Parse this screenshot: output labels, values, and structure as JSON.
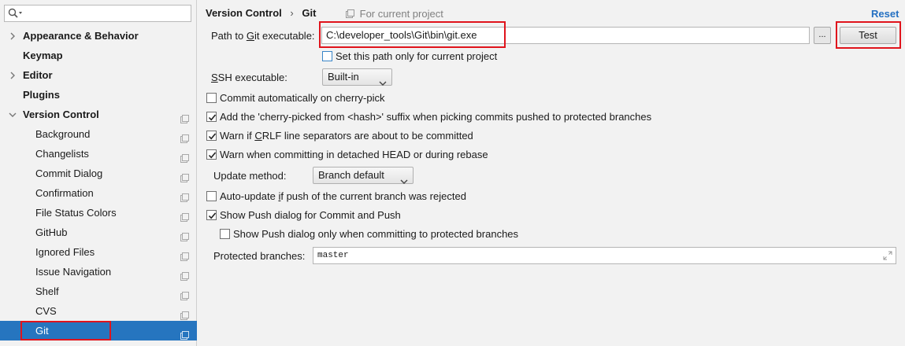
{
  "sidebar": {
    "search": {
      "value": ""
    },
    "items": [
      {
        "label": "Appearance & Behavior",
        "level": "top",
        "arrow": "right",
        "project": false
      },
      {
        "label": "Keymap",
        "level": "top",
        "arrow": "none",
        "project": false
      },
      {
        "label": "Editor",
        "level": "top",
        "arrow": "right",
        "project": false
      },
      {
        "label": "Plugins",
        "level": "top",
        "arrow": "none",
        "project": false
      },
      {
        "label": "Version Control",
        "level": "top",
        "arrow": "down",
        "project": true
      },
      {
        "label": "Background",
        "level": "sub",
        "project": true
      },
      {
        "label": "Changelists",
        "level": "sub",
        "project": true
      },
      {
        "label": "Commit Dialog",
        "level": "sub",
        "project": true
      },
      {
        "label": "Confirmation",
        "level": "sub",
        "project": true
      },
      {
        "label": "File Status Colors",
        "level": "sub",
        "project": true
      },
      {
        "label": "GitHub",
        "level": "sub",
        "project": true
      },
      {
        "label": "Ignored Files",
        "level": "sub",
        "project": true
      },
      {
        "label": "Issue Navigation",
        "level": "sub",
        "project": true
      },
      {
        "label": "Shelf",
        "level": "sub",
        "project": true
      },
      {
        "label": "CVS",
        "level": "sub",
        "project": true
      },
      {
        "label": "Git",
        "level": "sub",
        "project": true,
        "selected": true
      }
    ]
  },
  "header": {
    "breadcrumb_parent": "Version Control",
    "breadcrumb_separator": "›",
    "breadcrumb_current": "Git",
    "for_project": "For current project",
    "reset_label": "Reset"
  },
  "git_path": {
    "label_pre": "Path to ",
    "label_mn": "G",
    "label_post": "it executable:",
    "value": "C:\\developer_tools\\Git\\bin\\git.exe",
    "browse_label": "...",
    "test_label": "Test",
    "current_project_only": {
      "label": "Set this path only for current project",
      "checked": false
    }
  },
  "ssh": {
    "label_mn": "S",
    "label_post": "SH executable:",
    "selected": "Built-in"
  },
  "options": {
    "cherry_pick_commit": {
      "label": "Commit automatically on cherry-pick",
      "checked": false
    },
    "cherry_pick_suffix": {
      "label": "Add the 'cherry-picked from <hash>' suffix when picking commits pushed to protected branches",
      "checked": true
    },
    "crlf_pre": "Warn if ",
    "crlf_mn": "C",
    "crlf_post": "RLF line separators are about to be committed",
    "crlf_checked": true,
    "detached_head": {
      "label": "Warn when committing in detached HEAD or during rebase",
      "checked": true
    },
    "update_method": {
      "label": "Update method:",
      "selected": "Branch default"
    },
    "auto_update_pre": "Auto-update ",
    "auto_update_mn": "i",
    "auto_update_post": "f push of the current branch was rejected",
    "auto_update_checked": false,
    "show_push": {
      "label": "Show Push dialog for Commit and Push",
      "checked": true
    },
    "show_push_protected": {
      "label": "Show Push dialog only when committing to protected branches",
      "checked": false
    }
  },
  "protected_branches": {
    "label": "Protected branches:",
    "value": "master"
  },
  "colors": {
    "accent": "#2675bf",
    "link": "#2470c2",
    "highlight": "#e0141c"
  }
}
